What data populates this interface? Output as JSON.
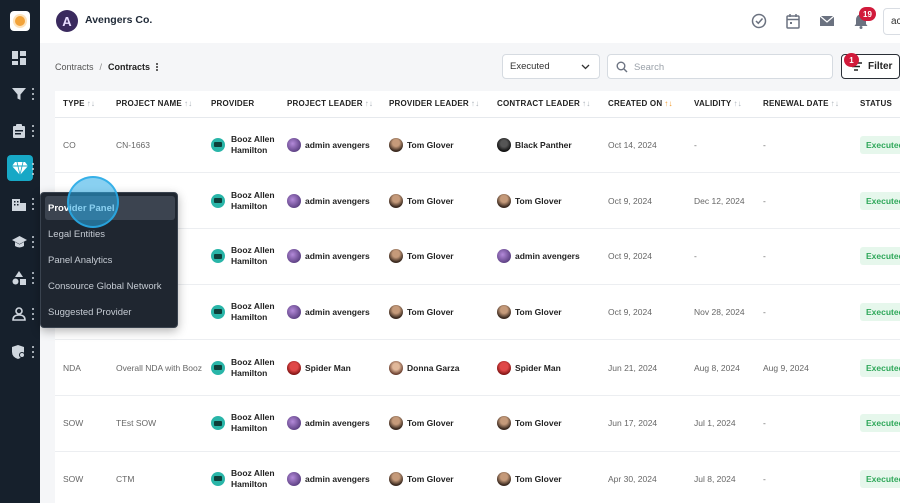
{
  "header": {
    "brand_name": "Avengers Co.",
    "brand_initial": "A",
    "notification_count": "19",
    "user_initials": "ac"
  },
  "breadcrumb": {
    "parent": "Contracts",
    "separator": "/",
    "current": "Contracts"
  },
  "toolbar": {
    "status_value": "Executed",
    "search_placeholder": "Search",
    "filter_label": "Filter",
    "filter_count": "1"
  },
  "table": {
    "columns": [
      {
        "label": "TYPE",
        "sortable": true
      },
      {
        "label": "PROJECT NAME",
        "sortable": true
      },
      {
        "label": "PROVIDER",
        "sortable": false
      },
      {
        "label": "PROJECT LEADER",
        "sortable": true
      },
      {
        "label": "PROVIDER LEADER",
        "sortable": true
      },
      {
        "label": "CONTRACT LEADER",
        "sortable": true
      },
      {
        "label": "CREATED ON",
        "sortable": true,
        "active": true
      },
      {
        "label": "VALIDITY",
        "sortable": true
      },
      {
        "label": "RENEWAL DATE",
        "sortable": true
      },
      {
        "label": "STATUS",
        "sortable": false
      }
    ],
    "rows": [
      {
        "type": "CO",
        "project": "CN-1663",
        "provider": "Booz Allen Hamilton",
        "project_leader": "admin avengers",
        "pl_av": "admin",
        "provider_leader": "Tom Glover",
        "pv_av": "tom",
        "contract_leader": "Black Panther",
        "cl_av": "panther",
        "created": "Oct 14, 2024",
        "validity": "-",
        "renewal": "-",
        "status": "Executed"
      },
      {
        "type": "",
        "project": "",
        "provider": "Booz Allen Hamilton",
        "project_leader": "admin avengers",
        "pl_av": "admin",
        "provider_leader": "Tom Glover",
        "pv_av": "tom",
        "contract_leader": "Tom Glover",
        "cl_av": "tom",
        "created": "Oct 9, 2024",
        "validity": "Dec 12, 2024",
        "renewal": "-",
        "status": "Executed"
      },
      {
        "type": "",
        "project": "",
        "provider": "Booz Allen Hamilton",
        "project_leader": "admin avengers",
        "pl_av": "admin",
        "provider_leader": "Tom Glover",
        "pv_av": "tom",
        "contract_leader": "admin avengers",
        "cl_av": "admin",
        "created": "Oct 9, 2024",
        "validity": "-",
        "renewal": "-",
        "status": "Executed"
      },
      {
        "type": "",
        "project": "",
        "provider": "Booz Allen Hamilton",
        "project_leader": "admin avengers",
        "pl_av": "admin",
        "provider_leader": "Tom Glover",
        "pv_av": "tom",
        "contract_leader": "Tom Glover",
        "cl_av": "tom",
        "created": "Oct 9, 2024",
        "validity": "Nov 28, 2024",
        "renewal": "-",
        "status": "Executed"
      },
      {
        "type": "NDA",
        "project": "Overall NDA with Booz",
        "provider": "Booz Allen Hamilton",
        "project_leader": "Spider Man",
        "pl_av": "spider",
        "provider_leader": "Donna Garza",
        "pv_av": "donna",
        "contract_leader": "Spider Man",
        "cl_av": "spider",
        "created": "Jun 21, 2024",
        "validity": "Aug 8, 2024",
        "renewal": "Aug 9, 2024",
        "status": "Executed"
      },
      {
        "type": "SOW",
        "project": "TEst SOW",
        "provider": "Booz Allen Hamilton",
        "project_leader": "admin avengers",
        "pl_av": "admin",
        "provider_leader": "Tom Glover",
        "pv_av": "tom",
        "contract_leader": "Tom Glover",
        "cl_av": "tom",
        "created": "Jun 17, 2024",
        "validity": "Jul 1, 2024",
        "renewal": "-",
        "status": "Executed"
      },
      {
        "type": "SOW",
        "project": "CTM",
        "provider": "Booz Allen Hamilton",
        "project_leader": "admin avengers",
        "pl_av": "admin",
        "provider_leader": "Tom Glover",
        "pv_av": "tom",
        "contract_leader": "Tom Glover",
        "cl_av": "tom",
        "created": "Apr 30, 2024",
        "validity": "Jul 8, 2024",
        "renewal": "-",
        "status": "Executed"
      }
    ]
  },
  "popup_menu": {
    "items": [
      {
        "label": "Provider Panel",
        "active": true
      },
      {
        "label": "Legal Entities"
      },
      {
        "label": "Panel Analytics"
      },
      {
        "label": "Consource Global Network"
      },
      {
        "label": "Suggested Provider"
      }
    ]
  },
  "colors": {
    "rail_bg": "#16202c",
    "accent": "#17a8c6",
    "badge_red": "#d11a3b",
    "status_green": "#2fa85a"
  }
}
